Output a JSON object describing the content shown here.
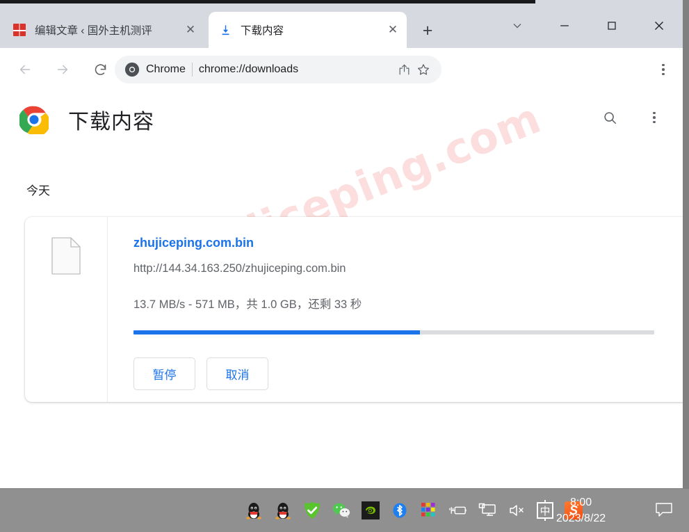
{
  "window": {
    "controls": [
      {
        "name": "tab-search",
        "glyph": "chevron-down"
      },
      {
        "name": "minimize",
        "glyph": "minus"
      },
      {
        "name": "maximize",
        "glyph": "square"
      },
      {
        "name": "close",
        "glyph": "cross"
      }
    ]
  },
  "tabs": [
    {
      "title": "编辑文章 ‹ 国外主机测评",
      "favicon": "red-seal-favicon",
      "active": false,
      "close_label": "✕"
    },
    {
      "title": "下载内容",
      "favicon": "download-icon",
      "active": true,
      "close_label": "✕"
    }
  ],
  "new_tab_label": "+",
  "toolbar": {
    "back_label": "←",
    "forward_label": "→",
    "reload_label": "⟳",
    "omnibox": {
      "chip_label": "Chrome",
      "url": "chrome://downloads",
      "share_icon": "share-icon",
      "bookmark_icon": "star-icon"
    },
    "menu_icon": "three-dot-menu-icon"
  },
  "page": {
    "logo": "chrome-logo",
    "title": "下载内容",
    "search_icon": "search-icon",
    "menu_icon": "three-dot-menu-icon",
    "watermark": "zhujiceping.com",
    "section_label": "今天",
    "download": {
      "file_icon": "generic-file-icon",
      "filename": "zhujiceping.com.bin",
      "url": "http://144.34.163.250/zhujiceping.com.bin",
      "status": "13.7 MB/s - 571 MB，共 1.0 GB，还剩 33 秒",
      "progress_percent": 55,
      "progress_color": "#1a73e8",
      "buttons": [
        {
          "label": "暂停",
          "name": "pause-download-button"
        },
        {
          "label": "取消",
          "name": "cancel-download-button"
        }
      ]
    }
  },
  "taskbar": {
    "tray_icons": [
      {
        "name": "qq-icon",
        "glyph": "penguin"
      },
      {
        "name": "qq-secondary-icon",
        "glyph": "penguin"
      },
      {
        "name": "antivirus-shield-icon",
        "glyph": "check"
      },
      {
        "name": "wechat-icon",
        "glyph": "wechat"
      },
      {
        "name": "nvidia-icon",
        "glyph": "nvidia"
      },
      {
        "name": "bluetooth-icon",
        "glyph": "bluetooth"
      },
      {
        "name": "color-squares-icon",
        "glyph": "squares"
      },
      {
        "name": "battery-icon",
        "glyph": "battery"
      },
      {
        "name": "display-icon",
        "glyph": "monitor"
      },
      {
        "name": "volume-muted-icon",
        "glyph": "speaker-mute"
      }
    ],
    "ime_label": "中",
    "sogou_label": "S",
    "time": "8:00",
    "date": "2023/8/22",
    "notification_icon": "notification-icon"
  }
}
